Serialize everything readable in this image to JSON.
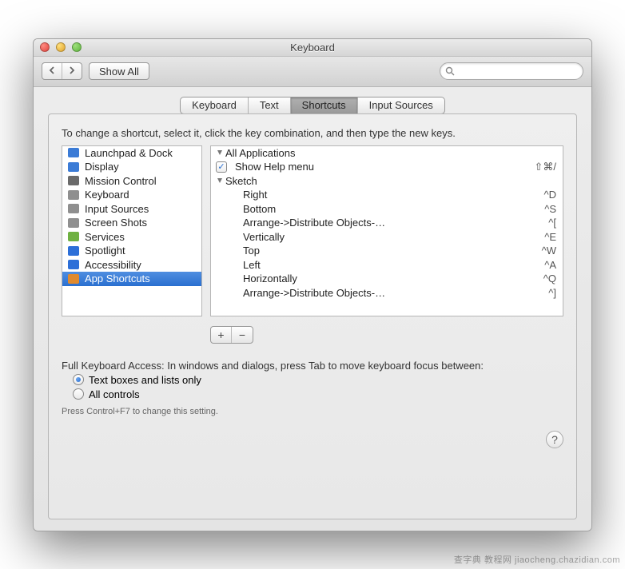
{
  "window": {
    "title": "Keyboard"
  },
  "toolbar": {
    "show_all": "Show All",
    "search_placeholder": ""
  },
  "tabs": {
    "items": [
      "Keyboard",
      "Text",
      "Shortcuts",
      "Input Sources"
    ],
    "active_index": 2
  },
  "instructions": "To change a shortcut, select it, click the key combination, and then type the new keys.",
  "categories": [
    {
      "label": "Launchpad & Dock",
      "icon": "launchpad-icon",
      "color": "#3b7bd6"
    },
    {
      "label": "Display",
      "icon": "display-icon",
      "color": "#3b7bd6"
    },
    {
      "label": "Mission Control",
      "icon": "mission-icon",
      "color": "#6a6a6a"
    },
    {
      "label": "Keyboard",
      "icon": "keyboard-icon",
      "color": "#8f8f8f"
    },
    {
      "label": "Input Sources",
      "icon": "input-icon",
      "color": "#8f8f8f"
    },
    {
      "label": "Screen Shots",
      "icon": "screenshot-icon",
      "color": "#8f8f8f"
    },
    {
      "label": "Services",
      "icon": "services-icon",
      "color": "#6fb142"
    },
    {
      "label": "Spotlight",
      "icon": "spotlight-icon",
      "color": "#2d6fd8"
    },
    {
      "label": "Accessibility",
      "icon": "accessibility-icon",
      "color": "#2d6fd8"
    },
    {
      "label": "App Shortcuts",
      "icon": "app-icon",
      "color": "#e08a2e",
      "selected": true
    }
  ],
  "shortcuts": {
    "groups": [
      {
        "name": "All Applications",
        "items": [
          {
            "label": "Show Help menu",
            "key": "⇧⌘/",
            "checked": true
          }
        ]
      },
      {
        "name": "Sketch",
        "items": [
          {
            "label": "Right",
            "key": "^D"
          },
          {
            "label": "Bottom",
            "key": "^S"
          },
          {
            "label": "Arrange->Distribute Objects-…",
            "key": "^["
          },
          {
            "label": "Vertically",
            "key": "^E"
          },
          {
            "label": "Top",
            "key": "^W"
          },
          {
            "label": "Left",
            "key": "^A"
          },
          {
            "label": "Horizontally",
            "key": "^Q"
          },
          {
            "label": "Arrange->Distribute Objects-…",
            "key": "^]"
          }
        ]
      }
    ]
  },
  "buttons": {
    "add": "+",
    "remove": "−"
  },
  "full_keyboard_access": {
    "label": "Full Keyboard Access: In windows and dialogs, press Tab to move keyboard focus between:",
    "option_text_boxes": "Text boxes and lists only",
    "option_all": "All controls",
    "selected": "text_boxes",
    "hint": "Press Control+F7 to change this setting."
  },
  "help_tooltip": "?",
  "watermark": "查字典 教程网  jiaocheng.chazidian.com"
}
